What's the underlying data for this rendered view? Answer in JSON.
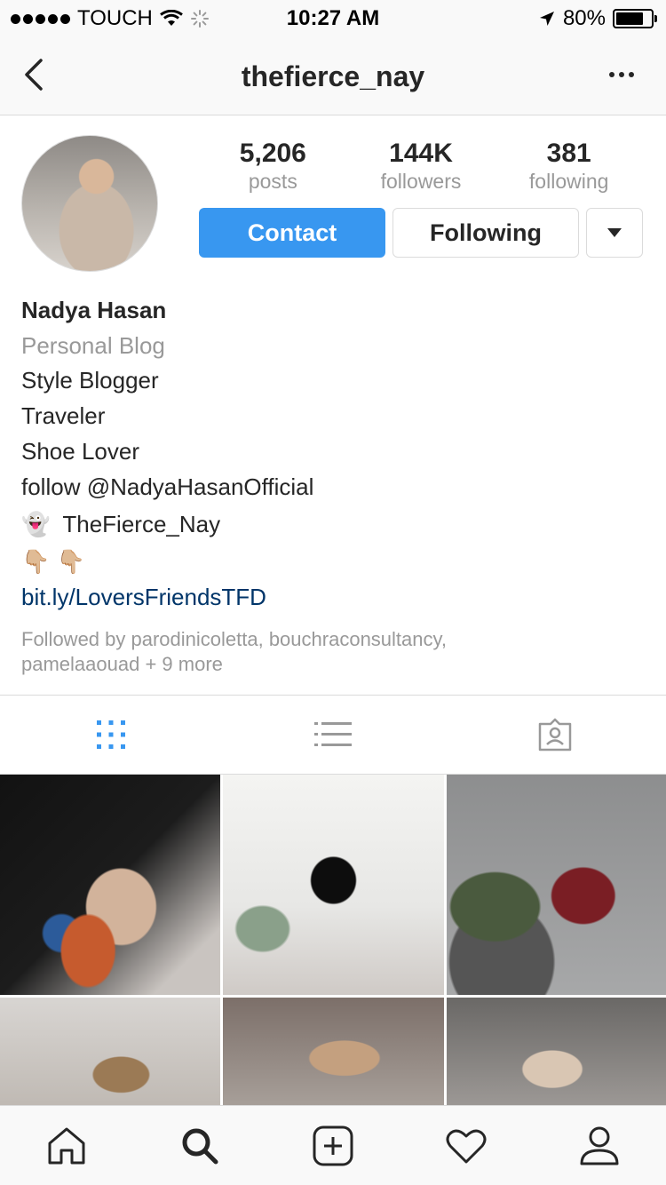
{
  "status_bar": {
    "carrier": "TOUCH",
    "time": "10:27 AM",
    "battery": "80%",
    "battery_level": 0.8,
    "icons": [
      "signal-dots",
      "wifi-icon",
      "activity-spinner-icon",
      "location-arrow-icon",
      "battery-icon"
    ]
  },
  "nav": {
    "title": "thefierce_nay",
    "back_icon": "chevron-left-icon",
    "more_icon": "more-dots-icon"
  },
  "stats": {
    "posts_value": "5,206",
    "posts_label": "posts",
    "followers_value": "144K",
    "followers_label": "followers",
    "following_value": "381",
    "following_label": "following"
  },
  "buttons": {
    "contact": "Contact",
    "following": "Following",
    "dropdown_icon": "caret-down-icon"
  },
  "bio": {
    "name": "Nadya Hasan",
    "category": "Personal Blog",
    "lines": [
      "Style Blogger",
      "Traveler",
      "Shoe Lover",
      "follow @NadyaHasanOfficial"
    ],
    "snapchat_emoji": "👻",
    "snapchat_name": "TheFierce_Nay",
    "pointing_emoji": "👇🏼 👇🏼",
    "link": "bit.ly/LoversFriendsTFD",
    "followed_by": "Followed by parodinicoletta, bouchraconsultancy, pamelaaouad + 9 more"
  },
  "tabs": {
    "items": [
      "grid-view-icon",
      "list-view-icon",
      "tagged-photos-icon"
    ],
    "active": "grid-view-icon"
  },
  "tabbar": {
    "items": [
      "home-icon",
      "search-icon",
      "new-post-icon",
      "activity-heart-icon",
      "profile-icon"
    ]
  },
  "colors": {
    "accent": "#3897f0",
    "link": "#003569",
    "muted": "#999999",
    "text": "#262626",
    "border": "#dbdbdb"
  }
}
